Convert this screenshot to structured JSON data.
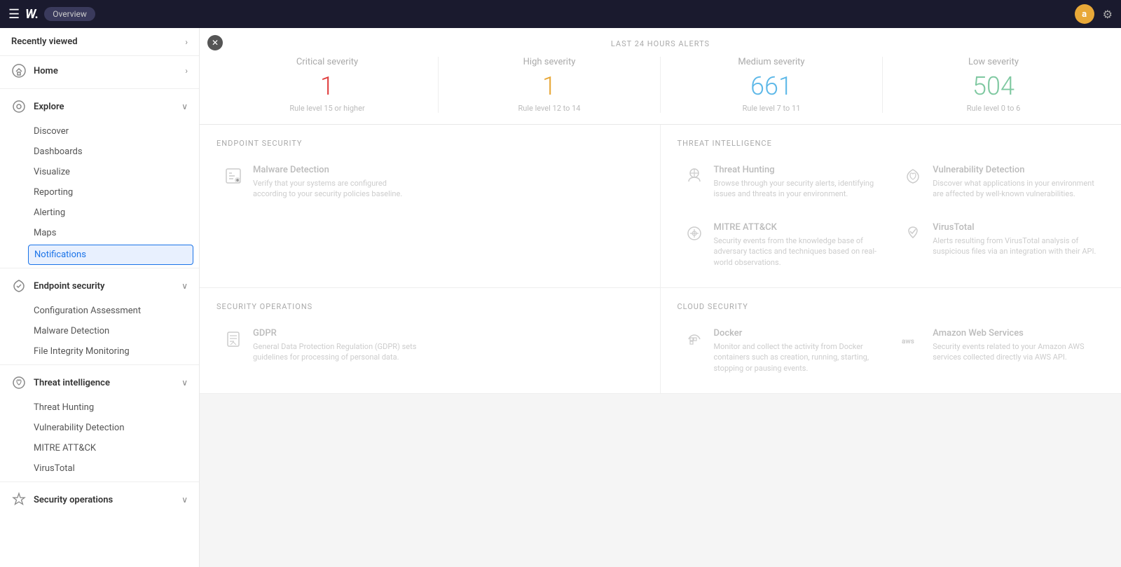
{
  "topbar": {
    "logo": "W.",
    "tab": "Overview",
    "user_initial": "a",
    "gear_label": "⚙"
  },
  "sidebar": {
    "recently_viewed_label": "Recently viewed",
    "recently_viewed_chevron": "›",
    "sections": [
      {
        "id": "home",
        "icon": "🏠",
        "label": "Home",
        "chevron": "›",
        "items": []
      },
      {
        "id": "explore",
        "icon": "🔍",
        "label": "Explore",
        "chevron": "∨",
        "items": [
          "Discover",
          "Dashboards",
          "Visualize",
          "Reporting",
          "Alerting",
          "Maps",
          "Notifications"
        ]
      },
      {
        "id": "endpoint",
        "icon": "💓",
        "label": "Endpoint security",
        "chevron": "∨",
        "items": [
          "Configuration Assessment",
          "Malware Detection",
          "File Integrity Monitoring"
        ]
      },
      {
        "id": "threat",
        "icon": "🧠",
        "label": "Threat intelligence",
        "chevron": "∨",
        "items": [
          "Threat Hunting",
          "Vulnerability Detection",
          "MITRE ATT&CK",
          "VirusTotal"
        ]
      },
      {
        "id": "security_ops",
        "icon": "🛡",
        "label": "Security operations",
        "chevron": "∨",
        "items": []
      }
    ],
    "active_item": "Notifications"
  },
  "main": {
    "alerts_label": "LAST 24 HOURS ALERTS",
    "stats": [
      {
        "label": "Critical severity",
        "value": "1",
        "sub": "Rule level 15 or higher",
        "color_class": "critical"
      },
      {
        "label": "High severity",
        "value": "1",
        "sub": "Rule level 12 to 14",
        "color_class": "high"
      },
      {
        "label": "Medium severity",
        "value": "661",
        "sub": "Rule level 7 to 11",
        "color_class": "medium"
      },
      {
        "label": "Low severity",
        "value": "504",
        "sub": "Rule level 0 to 6",
        "color_class": "low"
      }
    ],
    "sections": [
      {
        "id": "endpoint_security",
        "label": "ENDPOINT SECURITY",
        "modules": [
          {
            "title": "Malware Detection",
            "desc": "Verify that your systems are configured according to your security policies baseline.",
            "icon": "📋"
          },
          {
            "title": "",
            "desc": "",
            "icon": ""
          }
        ]
      },
      {
        "id": "threat_intelligence",
        "label": "THREAT INTELLIGENCE",
        "modules": [
          {
            "title": "Threat Hunting",
            "desc": "Browse through your security alerts, identifying issues and threats in your environment.",
            "icon": "🎯"
          },
          {
            "title": "Vulnerability Detection",
            "desc": "Discover what applications in your environment are affected by well-known vulnerabilities.",
            "icon": "❤"
          },
          {
            "title": "MITRE ATT&CK",
            "desc": "Security events from the knowledge base of adversary tactics and techniques based on real-world observations.",
            "icon": "⚙"
          },
          {
            "title": "VirusTotal",
            "desc": "Alerts resulting from VirusTotal analysis of suspicious files via an integration with their API.",
            "icon": "❤"
          }
        ]
      },
      {
        "id": "security_operations",
        "label": "SECURITY OPERATIONS",
        "modules": [
          {
            "title": "GDPR",
            "desc": "General Data Protection Regulation (GDPR) sets guidelines for processing of personal data.",
            "icon": "📊"
          },
          {
            "title": "",
            "desc": "",
            "icon": ""
          }
        ]
      },
      {
        "id": "cloud_security",
        "label": "CLOUD SECURITY",
        "modules": [
          {
            "title": "Docker",
            "desc": "Monitor and collect the activity from Docker containers such as creation, running, starting, stopping or pausing events.",
            "icon": "🐳"
          },
          {
            "title": "Amazon Web Services",
            "desc": "Security events related to your Amazon AWS services collected directly via AWS API.",
            "icon": "☁"
          }
        ]
      }
    ]
  }
}
